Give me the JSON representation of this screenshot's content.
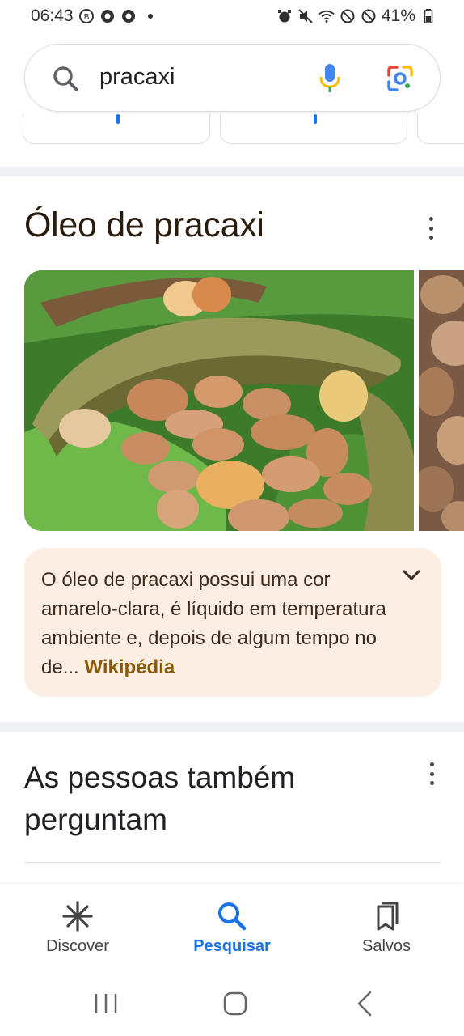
{
  "status_bar": {
    "time": "06:43",
    "battery": "41%",
    "left_icons": [
      "b-icon",
      "chrome-icon",
      "chrome-icon"
    ],
    "right_icons": [
      "alarm-icon",
      "mute-icon",
      "wifi-icon",
      "block-icon",
      "block-icon",
      "battery-icon"
    ]
  },
  "search": {
    "query": "pracaxi"
  },
  "knowledge_card": {
    "title": "Óleo de pracaxi",
    "description": "O óleo de pracaxi possui uma cor amarelo-clara, é líquido em temperatura ambiente e, depois de algum tempo no de...",
    "source": "Wikipédia"
  },
  "people_also_ask": {
    "title": "As pessoas também perguntam"
  },
  "bottom_nav": {
    "items": [
      {
        "label": "Discover",
        "icon": "discover-icon",
        "active": false
      },
      {
        "label": "Pesquisar",
        "icon": "search-icon",
        "active": true
      },
      {
        "label": "Salvos",
        "icon": "saved-icon",
        "active": false
      }
    ]
  },
  "colors": {
    "accent": "#1a73e8",
    "description_bg": "#fdeee3",
    "source_link": "#8a5a00"
  }
}
